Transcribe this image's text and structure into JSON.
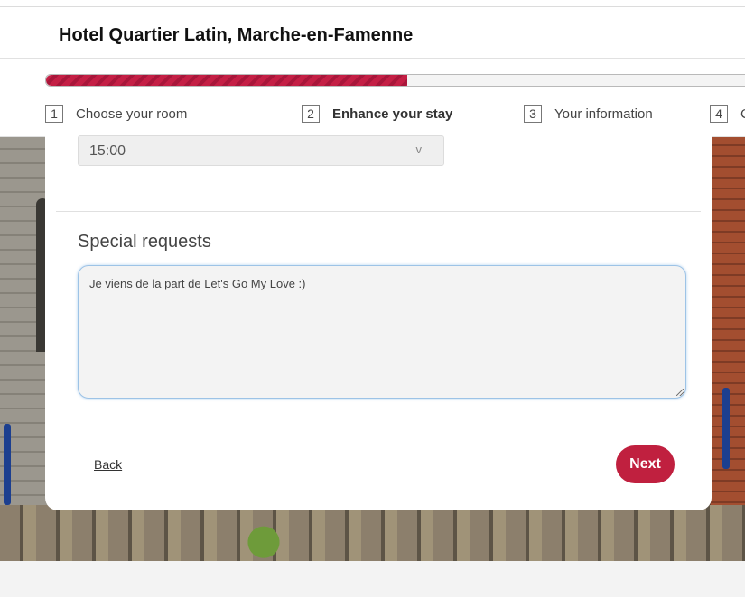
{
  "header": {
    "hotel_name": "Hotel Quartier Latin, Marche-en-Famenne"
  },
  "progress": {
    "fraction": 0.5
  },
  "steps": [
    {
      "number": "1",
      "label": "Choose your room"
    },
    {
      "number": "2",
      "label": "Enhance your stay",
      "active": true
    },
    {
      "number": "3",
      "label": "Your information"
    },
    {
      "number": "4",
      "label": "C"
    }
  ],
  "arrival_time": {
    "value": "15:00",
    "chevron": "v"
  },
  "special_requests": {
    "title": "Special requests",
    "text": "Je viens de la part de Let's Go My Love :)"
  },
  "actions": {
    "back_label": "Back",
    "next_label": "Next"
  },
  "colors": {
    "accent": "#c0203f",
    "progress_fill": "#c41f45"
  }
}
